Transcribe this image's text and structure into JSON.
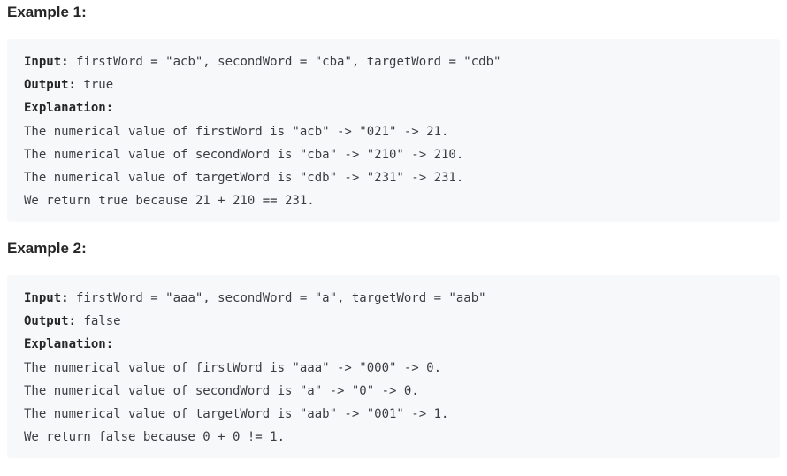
{
  "examples": [
    {
      "title": "Example 1:",
      "input_label": "Input:",
      "input_value": " firstWord = \"acb\", secondWord = \"cba\", targetWord = \"cdb\"",
      "output_label": "Output:",
      "output_value": " true",
      "explanation_label": "Explanation:",
      "explanation_lines": [
        "The numerical value of firstWord is \"acb\" -> \"021\" -> 21.",
        "The numerical value of secondWord is \"cba\" -> \"210\" -> 210.",
        "The numerical value of targetWord is \"cdb\" -> \"231\" -> 231.",
        "We return true because 21 + 210 == 231."
      ]
    },
    {
      "title": "Example 2:",
      "input_label": "Input:",
      "input_value": " firstWord = \"aaa\", secondWord = \"a\", targetWord = \"aab\"",
      "output_label": "Output:",
      "output_value": " false",
      "explanation_label": "Explanation:",
      "explanation_lines": [
        "The numerical value of firstWord is \"aaa\" -> \"000\" -> 0.",
        "The numerical value of secondWord is \"a\" -> \"0\" -> 0.",
        "The numerical value of targetWord is \"aab\" -> \"001\" -> 1.",
        "We return false because 0 + 0 != 1."
      ]
    }
  ]
}
